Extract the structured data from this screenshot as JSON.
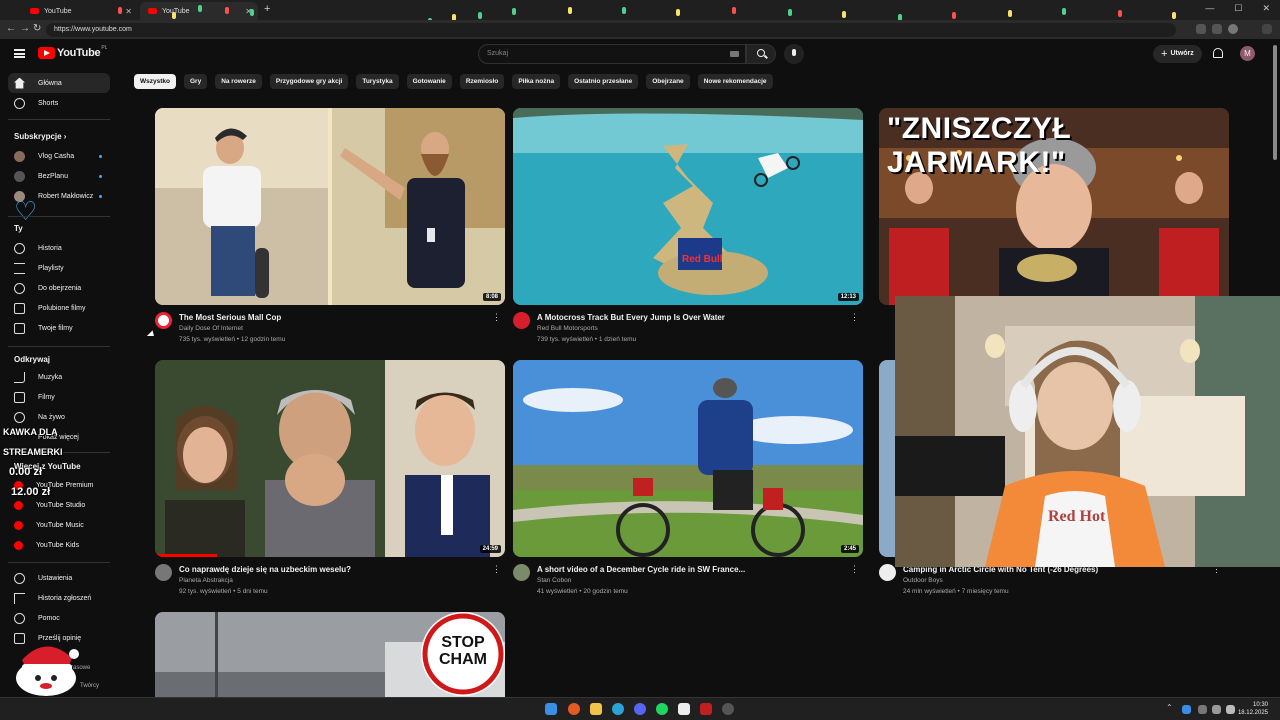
{
  "browser": {
    "tabs": [
      {
        "label": "YouTube"
      },
      {
        "label": "YouTube"
      }
    ],
    "url": "https://www.youtube.com"
  },
  "header": {
    "logo_text": "YouTube",
    "country_code": "PL",
    "search_placeholder": "Szukaj",
    "create_label": "Utwórz",
    "avatar_letter": "M"
  },
  "sidebar": {
    "main": [
      {
        "label": "Główna"
      },
      {
        "label": "Shorts"
      }
    ],
    "subscriptions_heading": "Subskrypcje",
    "subscriptions": [
      {
        "label": "Vlog Casha"
      },
      {
        "label": "BezPlanu"
      },
      {
        "label": "Robert Makłowicz"
      }
    ],
    "you_heading": "Ty",
    "you": [
      {
        "label": "Historia"
      },
      {
        "label": "Playlisty"
      },
      {
        "label": "Do obejrzenia"
      },
      {
        "label": "Polubione filmy"
      },
      {
        "label": "Twoje filmy"
      }
    ],
    "explore_heading": "Odkrywaj",
    "explore": [
      {
        "label": "Muzyka"
      },
      {
        "label": "Filmy"
      },
      {
        "label": "Na żywo"
      },
      {
        "label": "Pokaż więcej"
      }
    ],
    "more_heading": "Więcej z YouTube",
    "more": [
      {
        "label": "YouTube Premium"
      },
      {
        "label": "YouTube Studio"
      },
      {
        "label": "YouTube Music"
      },
      {
        "label": "YouTube Kids"
      }
    ],
    "settings": [
      {
        "label": "Ustawienia"
      },
      {
        "label": "Historia zgłoszeń"
      },
      {
        "label": "Pomoc"
      },
      {
        "label": "Prześlij opinię"
      },
      {
        "label": "Informacje prasowe"
      },
      {
        "label": "Twórcy"
      }
    ]
  },
  "chips": [
    "Wszystko",
    "Gry",
    "Na rowerze",
    "Przygodowe gry akcji",
    "Turystyka",
    "Gotowanie",
    "Rzemiosło",
    "Piłka nożna",
    "Ostatnio przesłane",
    "Obejrzane",
    "Nowe rekomendacje"
  ],
  "videos": [
    {
      "title": "The Most Serious Mall Cop",
      "channel": "Daily Dose Of Internet",
      "stats": "735 tys. wyświetleń • 12 godzin temu",
      "duration": "8:08"
    },
    {
      "title": "A Motocross Track But Every Jump Is Over Water",
      "channel": "Red Bull Motorsports",
      "stats": "739 tys. wyświetleń • 1 dzień temu",
      "duration": "12:13"
    },
    {
      "title": "Co naprawdę dzieje się na uzbeckim weselu?",
      "channel": "Planeta Abstrakcja",
      "stats": "92 tys. wyświetleń • 5 dni temu",
      "duration": "24:59"
    },
    {
      "title": "A short video of a December Cycle ride in SW France...",
      "channel": "Stan Cobon",
      "stats": "41 wyświetleń • 20 godzin temu",
      "duration": "2:45"
    },
    {
      "title": "Camping in Arctic Circle with No Tent (-26 Degrees)",
      "channel": "Outdoor Boys",
      "stats": "24 mln wyświetleń • 7 miesięcy temu"
    }
  ],
  "thumb_texts": {
    "zniszczyl": "\"ZNISZCZYŁ JARMARK!\"",
    "stop": "STOP",
    "cham": "CHAM",
    "redbull": "Red Bull",
    "shirt": "Red Hot"
  },
  "overlay": {
    "line1": "KAWKA DLA",
    "line2": "STREAMERKI",
    "amount_current": "0.00 zł",
    "amount_goal": "12.00 zł"
  },
  "taskbar": {
    "time": "10:30",
    "date": "18.12.2025"
  },
  "colors": {
    "accent": "#ff0000",
    "background": "#0f0f0f",
    "chip_bg": "#272727"
  }
}
